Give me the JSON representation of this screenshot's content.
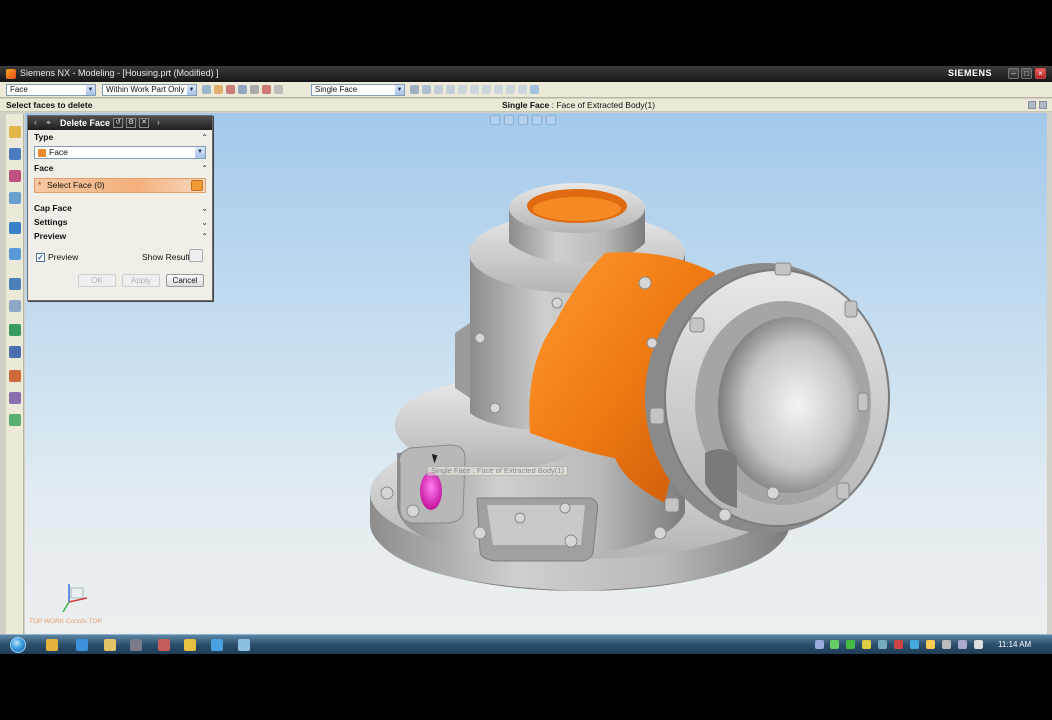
{
  "window": {
    "title": "Siemens NX - Modeling - [Housing.prt (Modified) ]",
    "brand": "SIEMENS"
  },
  "toolbar": {
    "type_filter": "Face",
    "scope_filter": "Within Work Part Only",
    "selection_intent": "Single Face"
  },
  "cue_line": {
    "cue": "Select faces to delete",
    "status_bold": "Single Face",
    "status_rest": " : Face of Extracted Body(1)"
  },
  "dialog": {
    "title": "Delete Face",
    "type_header": "Type",
    "type_value": "Face",
    "face_header": "Face",
    "select_face_label": "Select Face (0)",
    "cap_face_header": "Cap Face",
    "settings_header": "Settings",
    "preview_header": "Preview",
    "preview_checkbox_label": "Preview",
    "preview_checked": true,
    "show_result_label": "Show Result",
    "ok_label": "OK",
    "apply_label": "Apply",
    "cancel_label": "Cancel"
  },
  "viewport": {
    "tooltip": "Single Face : Face of Extracted Body(1)",
    "triad_label": "TOP WORK Coords TOP"
  },
  "colors": {
    "highlight_face": "#f07a12",
    "preselect": "#e020c0",
    "part_gray": "#a8a8a8"
  },
  "taskbar": {
    "clock": "11:14 AM"
  }
}
